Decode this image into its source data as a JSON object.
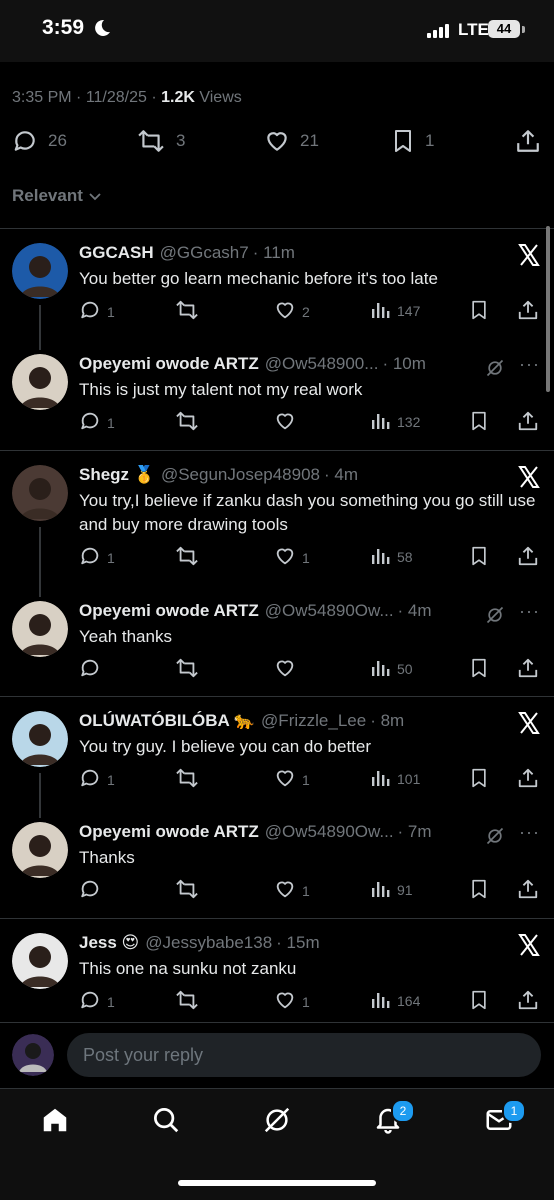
{
  "status": {
    "time": "3:59",
    "network": "LTE",
    "battery": "44"
  },
  "post_meta": {
    "time": "3:35 PM",
    "sep1": " · ",
    "date": "11/28/25",
    "sep2": " · ",
    "views": "1.2K",
    "views_label": " Views"
  },
  "post_stats": {
    "replies": "26",
    "reposts": "3",
    "likes": "21",
    "bookmarks": "1"
  },
  "sort_label": "Relevant",
  "replies": [
    {
      "name": "GGCASH",
      "handle": "@GGcash7",
      "time": "· 11m",
      "text": "You better go learn mechanic before it's too late",
      "reply_count": "1",
      "repost_count": "",
      "like_count": "2",
      "view_count": "147",
      "badge": "x",
      "avatar_color": "#1d5aa8"
    },
    {
      "name": "Opeyemi owode ARTZ",
      "handle": "@Ow548900...",
      "time": "· 10m",
      "text": "This is just my talent not my real work",
      "reply_count": "1",
      "repost_count": "",
      "like_count": "",
      "view_count": "132",
      "badge": "grok",
      "avatar_color": "#d8d0c4"
    },
    {
      "name": "Shegz 🥇",
      "handle": "@SegunJosep48908",
      "time": "· 4m",
      "text": "You try,I believe if zanku dash you something you go still use and buy more drawing tools",
      "reply_count": "1",
      "repost_count": "",
      "like_count": "1",
      "view_count": "58",
      "badge": "x",
      "avatar_color": "#4b3a34"
    },
    {
      "name": "Opeyemi owode ARTZ",
      "handle": "@Ow54890Ow...",
      "time": "· 4m",
      "text": "Yeah thanks",
      "reply_count": "",
      "repost_count": "",
      "like_count": "",
      "view_count": "50",
      "badge": "grok",
      "avatar_color": "#d8d0c4"
    },
    {
      "name": "OLÚWATÓBILÓBA 🐆",
      "handle": "@Frizzle_Lee",
      "time": "· 8m",
      "text": "You try guy. I believe you can do better",
      "reply_count": "1",
      "repost_count": "",
      "like_count": "1",
      "view_count": "101",
      "badge": "x",
      "avatar_color": "#b9d7e8"
    },
    {
      "name": "Opeyemi owode ARTZ",
      "handle": "@Ow54890Ow...",
      "time": "· 7m",
      "text": "Thanks",
      "reply_count": "",
      "repost_count": "",
      "like_count": "1",
      "view_count": "91",
      "badge": "grok",
      "avatar_color": "#d8d0c4"
    },
    {
      "name": "Jess 😍",
      "handle": "@Jessybabe138",
      "time": "· 15m",
      "text": "This one na sunku not zanku",
      "reply_count": "1",
      "repost_count": "",
      "like_count": "1",
      "view_count": "164",
      "badge": "x",
      "avatar_color": "#e8e8e8"
    }
  ],
  "compose": {
    "placeholder": "Post your reply"
  },
  "tabs": {
    "notifications_badge": "2",
    "messages_badge": "1"
  }
}
